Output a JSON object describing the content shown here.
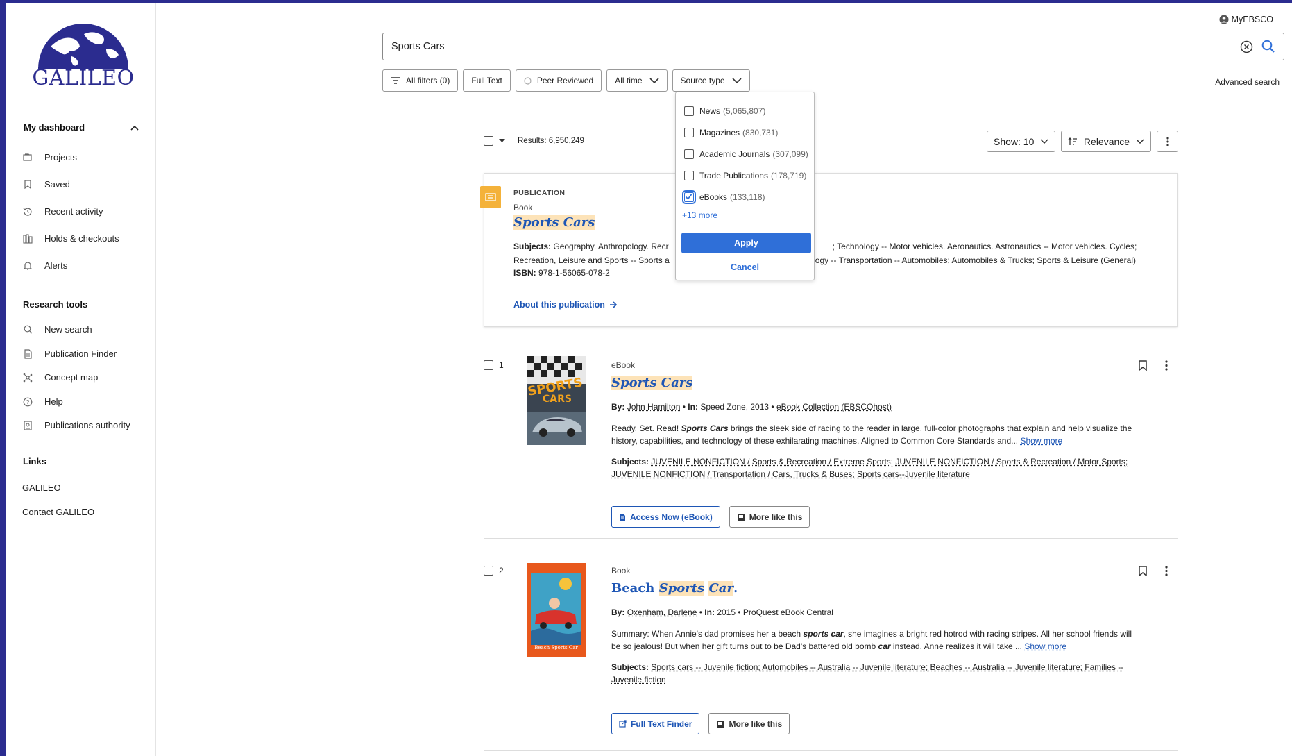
{
  "brand": {
    "name": "GALILEO",
    "primary_color": "#2b2c8f",
    "accent_color": "#2f6fd8"
  },
  "sidebar": {
    "dashboard_label": "My dashboard",
    "dashboard_items": [
      {
        "label": "Projects",
        "icon": "folders-icon"
      },
      {
        "label": "Saved",
        "icon": "bookmark-icon"
      },
      {
        "label": "Recent activity",
        "icon": "history-icon"
      },
      {
        "label": "Holds & checkouts",
        "icon": "books-icon"
      },
      {
        "label": "Alerts",
        "icon": "bell-icon"
      }
    ],
    "research_tools_label": "Research tools",
    "research_tools": [
      {
        "label": "New search",
        "icon": "search-icon"
      },
      {
        "label": "Publication Finder",
        "icon": "document-icon"
      },
      {
        "label": "Concept map",
        "icon": "concept-map-icon"
      },
      {
        "label": "Help",
        "icon": "help-icon"
      },
      {
        "label": "Publications authority",
        "icon": "authority-icon"
      }
    ],
    "links_label": "Links",
    "links": [
      "GALILEO",
      "Contact GALILEO"
    ]
  },
  "header": {
    "account_label": "MyEBSCO",
    "search_value": "Sports Cars",
    "advanced_search": "Advanced search"
  },
  "filters": {
    "all_filters": "All filters (0)",
    "full_text": "Full Text",
    "peer_reviewed": "Peer Reviewed",
    "date": "All time",
    "source_type": "Source type"
  },
  "source_type_dropdown": {
    "options": [
      {
        "label": "News",
        "count": "(5,065,807)",
        "checked": false
      },
      {
        "label": "Magazines",
        "count": "(830,731)",
        "checked": false
      },
      {
        "label": "Academic Journals",
        "count": "(307,099)",
        "checked": false
      },
      {
        "label": "Trade Publications",
        "count": "(178,719)",
        "checked": false
      },
      {
        "label": "eBooks",
        "count": "(133,118)",
        "checked": true
      }
    ],
    "more": "+13 more",
    "apply": "Apply",
    "cancel": "Cancel"
  },
  "results_bar": {
    "results_text": "Results: 6,950,249",
    "show": "Show: 10",
    "sort": "Relevance"
  },
  "publication": {
    "label": "PUBLICATION",
    "type": "Book",
    "title": "Sports Cars",
    "subjects_label": "Subjects:",
    "subjects_line1": "Geography. Anthropology. Recr",
    "subjects_line1_end": "; Technology -- Motor vehicles. Aeronautics. Astronautics -- Motor vehicles. Cycles;",
    "subjects_line2": "Recreation, Leisure and Sports -- Sports a",
    "subjects_line2_end": "ogy -- Transportation -- Automobiles; Automobiles & Trucks; Sports & Leisure (General)",
    "isbn_label": "ISBN:",
    "isbn": "978-1-56065-078-2",
    "about": "About this publication"
  },
  "results": [
    {
      "number": "1",
      "type": "eBook",
      "title": "Sports Cars",
      "by_label": "By:",
      "author": "John Hamilton",
      "in_label": "In:",
      "in_value": "Speed Zone, 2013",
      "collection": "eBook Collection (EBSCOhost)",
      "abstract_pre": "Ready. Set. Read! ",
      "abstract_bold": "Sports Cars",
      "abstract_post": " brings the sleek side of racing to the reader in large, full-color photographs that explain and help visualize the history, capabilities, and technology of these exhilarating machines. Aligned to Common Core Standards and...",
      "show_more": "Show more",
      "subjects_label": "Subjects:",
      "subjects_text": "JUVENILE NONFICTION / Sports & Recreation / Extreme Sports; JUVENILE NONFICTION / Sports & Recreation / Motor Sports; JUVENILE NONFICTION / Transportation / Cars, Trucks & Buses; Sports cars--Juvenile literature",
      "action1": "Access Now (eBook)",
      "action2": "More like this"
    },
    {
      "number": "2",
      "type": "Book",
      "title_pre": "Beach ",
      "title_hl1": "Sports",
      "title_hl2": "Car",
      "title_post": ".",
      "by_label": "By:",
      "author": "Oxenham, Darlene",
      "in_label": "In:",
      "in_value": "2015",
      "collection": "ProQuest eBook Central",
      "abstract_pre": "Summary: When Annie's dad promises her a beach ",
      "abstract_bold": "sports car",
      "abstract_mid": ", she imagines a bright red hotrod with racing stripes. All her school friends will be so jealous! But when her gift turns out to be Dad's battered old bomb ",
      "abstract_bold2": "car",
      "abstract_post": " instead, Anne realizes it will take ...",
      "show_more": "Show more",
      "subjects_label": "Subjects:",
      "subjects_text": "Sports cars -- Juvenile fiction; Automobiles -- Australia -- Juvenile literature; Beaches -- Australia -- Juvenile literature; Families -- Juvenile fiction",
      "cover_title": "Beach Sports Car",
      "action1": "Full Text Finder",
      "action2": "More like this"
    }
  ]
}
